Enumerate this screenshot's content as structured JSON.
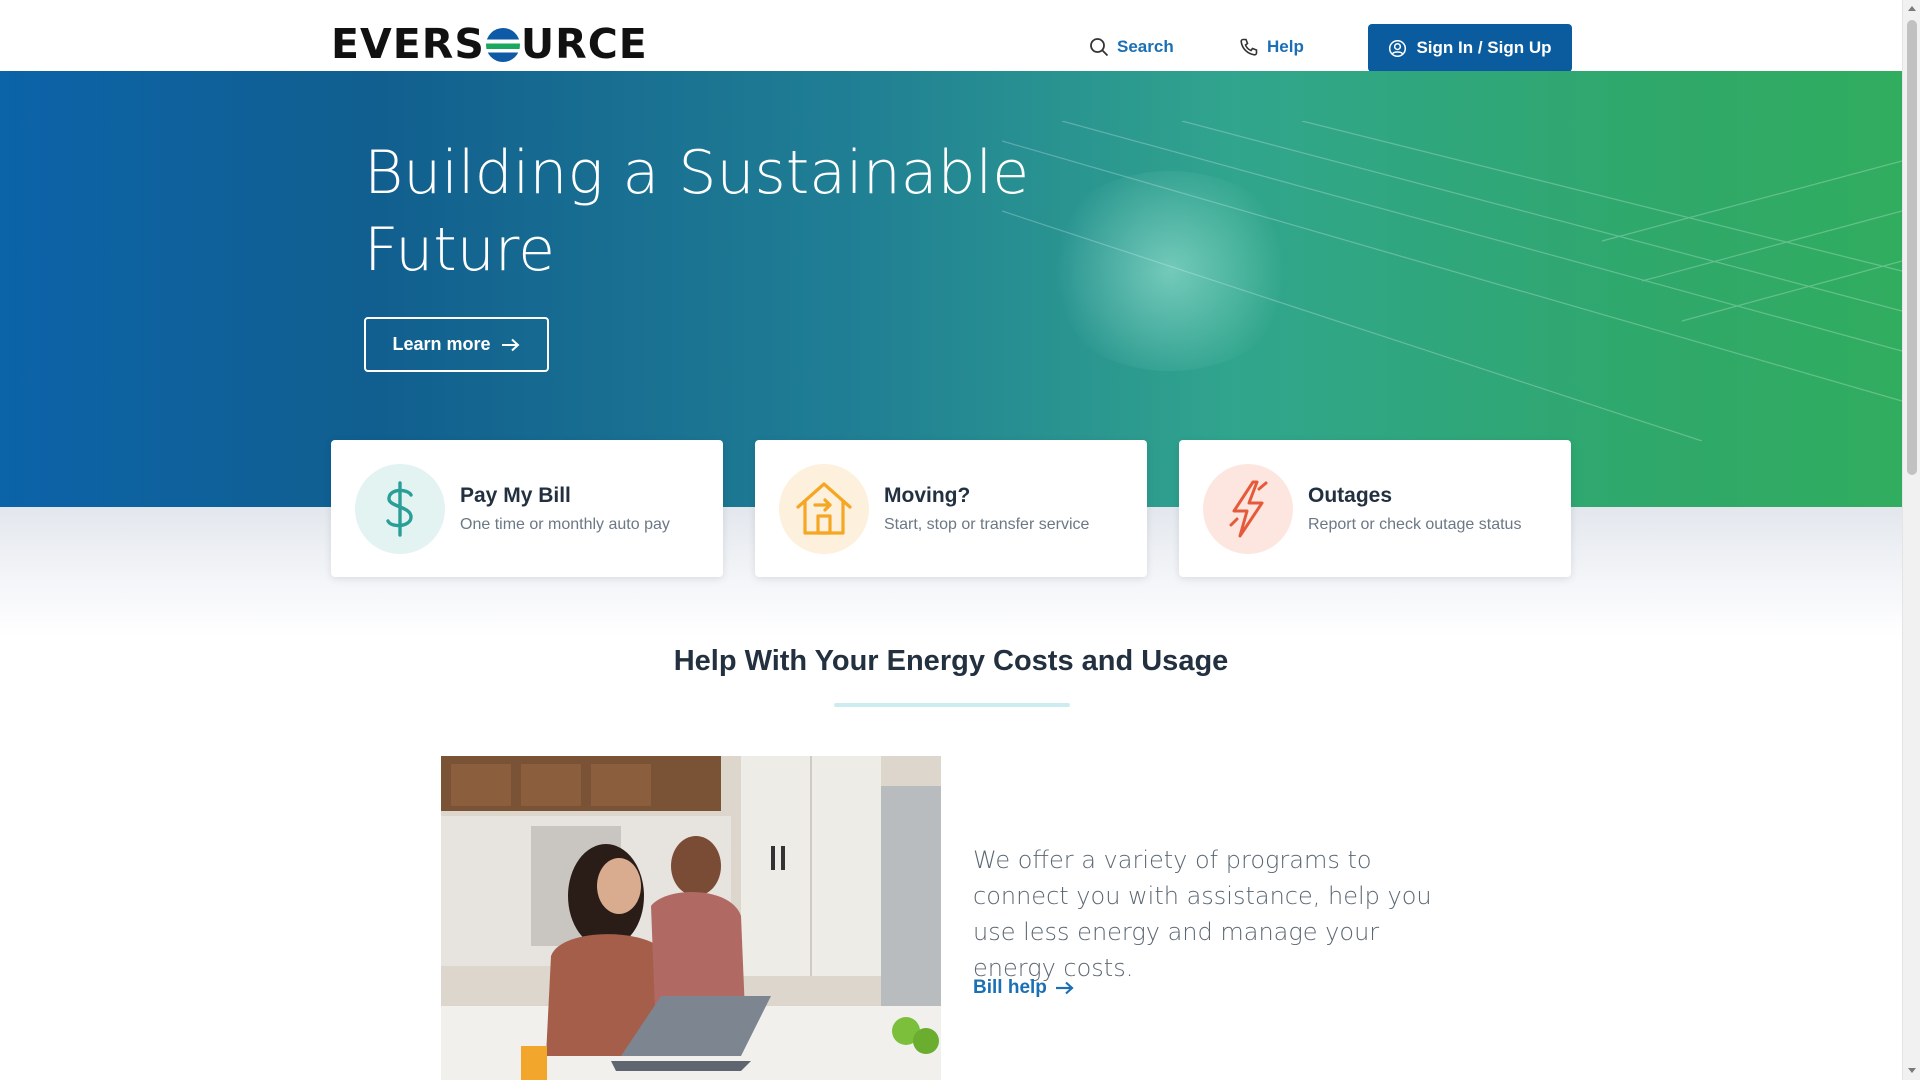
{
  "header": {
    "logo_left": "EVERS",
    "logo_right": "URCE",
    "search_label": "Search",
    "help_label": "Help",
    "signin_label": "Sign In / Sign Up"
  },
  "hero": {
    "title_line1": "Building a Sustainable",
    "title_line2": "Future",
    "cta_label": "Learn more"
  },
  "cards": [
    {
      "title": "Pay My Bill",
      "subtitle": "One time or monthly auto pay",
      "icon": "dollar-icon",
      "color": "#2a9e97"
    },
    {
      "title": "Moving?",
      "subtitle": "Start, stop or transfer service",
      "icon": "house-arrow-icon",
      "color": "#f5a623"
    },
    {
      "title": "Outages",
      "subtitle": "Report or check outage status",
      "icon": "lightning-bolt-icon",
      "color": "#e65a3c"
    }
  ],
  "section": {
    "title": "Help With Your Energy Costs and Usage",
    "body": "We offer a variety of programs to connect you with assistance, help you use less energy and manage your energy costs.",
    "link_label": "Bill help"
  },
  "colors": {
    "brand_blue": "#0a5c9f",
    "link_blue": "#1a6fb5",
    "brand_green": "#1aa760"
  }
}
